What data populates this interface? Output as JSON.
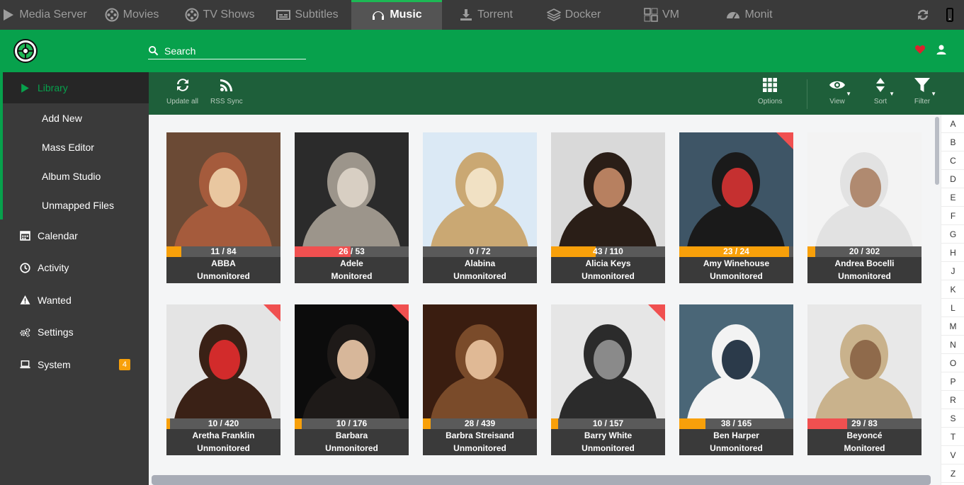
{
  "topnav": {
    "tabs": [
      {
        "label": "Media Server",
        "icon": "play-icon",
        "active": false
      },
      {
        "label": "Movies",
        "icon": "film-reel-icon",
        "active": false
      },
      {
        "label": "TV Shows",
        "icon": "film-reel-icon",
        "active": false
      },
      {
        "label": "Subtitles",
        "icon": "subtitles-icon",
        "active": false
      },
      {
        "label": "Music",
        "icon": "headphones-icon",
        "active": true
      },
      {
        "label": "Torrent",
        "icon": "download-icon",
        "active": false
      },
      {
        "label": "Docker",
        "icon": "layers-icon",
        "active": false
      },
      {
        "label": "VM",
        "icon": "vm-icon",
        "active": false
      },
      {
        "label": "Monit",
        "icon": "dashboard-icon",
        "active": false
      }
    ],
    "right_icons": [
      "refresh-icon",
      "mobile-icon"
    ]
  },
  "header": {
    "search_placeholder": "Search",
    "right_icons": [
      "heart-icon",
      "user-icon"
    ]
  },
  "sidebar": {
    "library_label": "Library",
    "sub_items": [
      "Add New",
      "Mass Editor",
      "Album Studio",
      "Unmapped Files"
    ],
    "main_items": [
      {
        "label": "Calendar",
        "icon": "calendar-icon"
      },
      {
        "label": "Activity",
        "icon": "clock-icon"
      },
      {
        "label": "Wanted",
        "icon": "warning-icon"
      },
      {
        "label": "Settings",
        "icon": "gears-icon"
      },
      {
        "label": "System",
        "icon": "laptop-icon",
        "badge": "4"
      }
    ]
  },
  "toolbar": {
    "update_all": "Update all",
    "rss_sync": "RSS Sync",
    "options": "Options",
    "view": "View",
    "sort": "Sort",
    "filter": "Filter"
  },
  "colors": {
    "accent": "#07a14c",
    "toolbar_bg": "#1e5f3a",
    "progress_orange": "#f8a00a",
    "progress_red": "#f05050"
  },
  "artists": [
    {
      "name": "ABBA",
      "status": "Unmonitored",
      "progress": "11 / 84",
      "fraction": 0.13,
      "bar_color": "#f8a00a",
      "corner": false,
      "palette": [
        "#6b4a35",
        "#a55b3c",
        "#e9c7a0"
      ]
    },
    {
      "name": "Adele",
      "status": "Monitored",
      "progress": "26 / 53",
      "fraction": 0.49,
      "bar_color": "#f05050",
      "corner": false,
      "palette": [
        "#2b2b2b",
        "#9c958b",
        "#d8cfc3"
      ]
    },
    {
      "name": "Alabina",
      "status": "Unmonitored",
      "progress": "0 / 72",
      "fraction": 0.0,
      "bar_color": "#f8a00a",
      "corner": false,
      "palette": [
        "#dbe9f5",
        "#caa873",
        "#f1e1c4"
      ]
    },
    {
      "name": "Alicia Keys",
      "status": "Unmonitored",
      "progress": "43 / 110",
      "fraction": 0.39,
      "bar_color": "#f8a00a",
      "corner": false,
      "palette": [
        "#d9d9d9",
        "#2a1e17",
        "#b78060"
      ]
    },
    {
      "name": "Amy Winehouse",
      "status": "Unmonitored",
      "progress": "23 / 24",
      "fraction": 0.96,
      "bar_color": "#f8a00a",
      "corner": true,
      "palette": [
        "#3e5566",
        "#1a1a1a",
        "#c53030"
      ]
    },
    {
      "name": "Andrea Bocelli",
      "status": "Unmonitored",
      "progress": "20 / 302",
      "fraction": 0.07,
      "bar_color": "#f8a00a",
      "corner": false,
      "palette": [
        "#f3f3f3",
        "#e2e2e2",
        "#b08a70"
      ]
    },
    {
      "name": "Aretha Franklin",
      "status": "Unmonitored",
      "progress": "10 / 420",
      "fraction": 0.03,
      "bar_color": "#f8a00a",
      "corner": true,
      "palette": [
        "#e4e4e4",
        "#3a2116",
        "#d22b2b"
      ]
    },
    {
      "name": "Barbara",
      "status": "Unmonitored",
      "progress": "10 / 176",
      "fraction": 0.06,
      "bar_color": "#f8a00a",
      "corner": true,
      "palette": [
        "#0c0c0c",
        "#1e1a18",
        "#d7b79a"
      ]
    },
    {
      "name": "Barbra Streisand",
      "status": "Unmonitored",
      "progress": "28 / 439",
      "fraction": 0.07,
      "bar_color": "#f8a00a",
      "corner": false,
      "palette": [
        "#3a1d10",
        "#7a4b2a",
        "#e0b995"
      ]
    },
    {
      "name": "Barry White",
      "status": "Unmonitored",
      "progress": "10 / 157",
      "fraction": 0.06,
      "bar_color": "#f8a00a",
      "corner": true,
      "palette": [
        "#e6e6e6",
        "#2b2b2b",
        "#8a8a8a"
      ]
    },
    {
      "name": "Ben Harper",
      "status": "Unmonitored",
      "progress": "38 / 165",
      "fraction": 0.23,
      "bar_color": "#f8a00a",
      "corner": false,
      "palette": [
        "#4a6677",
        "#f3f3f3",
        "#2b3a4a"
      ]
    },
    {
      "name": "Beyoncé",
      "status": "Monitored",
      "progress": "29 / 83",
      "fraction": 0.35,
      "bar_color": "#f05050",
      "corner": false,
      "palette": [
        "#e8e8e8",
        "#c9b28c",
        "#8f6a4b"
      ]
    }
  ],
  "alphabet": [
    "A",
    "B",
    "C",
    "D",
    "E",
    "F",
    "G",
    "H",
    "J",
    "K",
    "L",
    "M",
    "N",
    "O",
    "P",
    "R",
    "S",
    "T",
    "V",
    "Z"
  ]
}
